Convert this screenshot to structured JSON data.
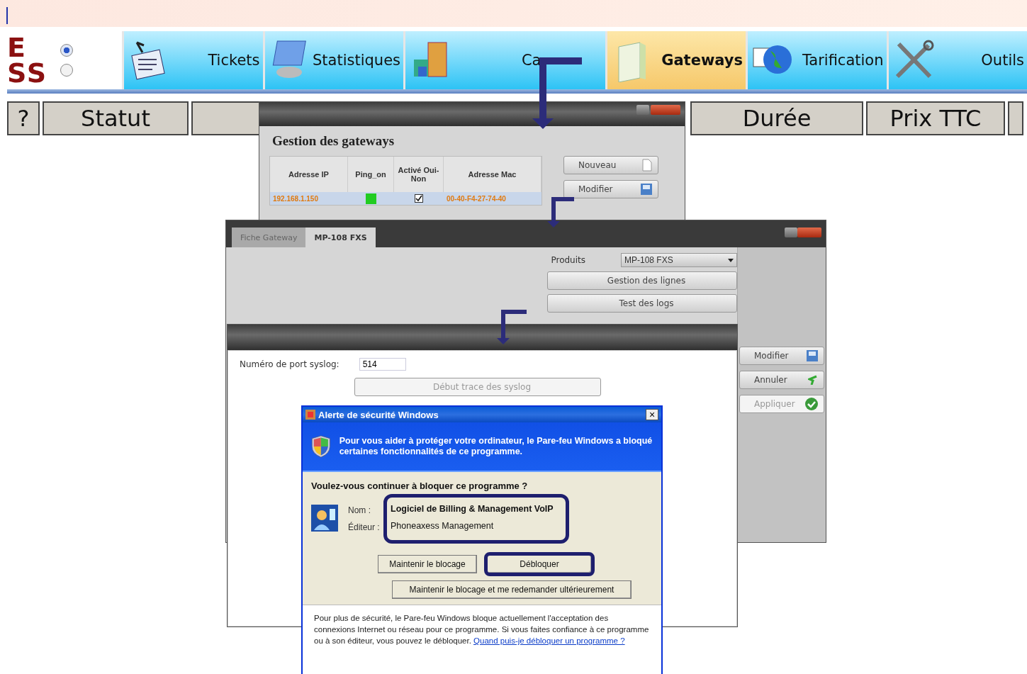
{
  "logo": {
    "lines": [
      "E",
      "SS"
    ]
  },
  "mode_radios": [
    {
      "selected": true
    },
    {
      "selected": false
    }
  ],
  "nav_tabs": [
    {
      "label": "Tickets",
      "selected": false
    },
    {
      "label": "Statistiques",
      "selected": false
    },
    {
      "label": "Ca",
      "selected": false
    },
    {
      "label": "Gateways",
      "selected": true
    },
    {
      "label": "Tarification",
      "selected": false
    },
    {
      "label": "Outils",
      "selected": false
    }
  ],
  "table_header": {
    "left": [
      "?",
      "Statut"
    ],
    "right": [
      "Durée",
      "Prix TTC"
    ]
  },
  "gateways_window": {
    "title": "Gestion des gateways",
    "columns": [
      "Adresse IP",
      "Ping_on",
      "Activé Oui-Non",
      "Adresse Mac"
    ],
    "rows": [
      {
        "ip": "192.168.1.150",
        "ping_on": true,
        "active": true,
        "mac": "00-40-F4-27-74-40",
        "selected": true
      }
    ],
    "buttons": [
      "Nouveau",
      "Modifier"
    ]
  },
  "gateway_window": {
    "tabs": [
      {
        "label": "Fiche Gateway",
        "selected": false
      },
      {
        "label": "MP-108 FXS",
        "selected": true
      }
    ],
    "product_label": "Produits",
    "product_value": "MP-108 FXS",
    "buttons": [
      "Gestion des lignes",
      "Test des logs"
    ],
    "side_buttons": [
      {
        "label": "Modifier",
        "disabled": false
      },
      {
        "label": "Annuler",
        "disabled": false
      },
      {
        "label": "Appliquer",
        "disabled": true
      }
    ]
  },
  "syslog_window": {
    "port_label": "Numéro de port syslog:",
    "port_value": "514",
    "trace_button": {
      "label": "Début trace des syslog",
      "disabled": true
    }
  },
  "security_alert": {
    "title": "Alerte de sécurité Windows",
    "close": "×",
    "banner": "Pour vous aider à protéger votre ordinateur, le Pare-feu Windows a bloqué certaines fonctionnalités de ce programme.",
    "question": "Voulez-vous continuer à bloquer ce programme ?",
    "fields": [
      {
        "label": "Nom :",
        "value": "Logiciel de Billing & Management VoIP",
        "bold": true
      },
      {
        "label": "Éditeur :",
        "value": "Phoneaxess Management",
        "bold": false
      }
    ],
    "buttons": [
      {
        "label": "Maintenir le blocage",
        "highlighted": false
      },
      {
        "label": "Débloquer",
        "highlighted": true
      }
    ],
    "wide_button": "Maintenir le blocage et me redemander ultérieurement",
    "footer": "Pour plus de sécurité, le Pare-feu Windows bloque actuellement l'acceptation des connexions Internet ou réseau pour ce programme. Si vous faites confiance à ce programme ou à son éditeur, vous pouvez le débloquer.",
    "footer_link": "Quand puis-je débloquer un programme ?"
  }
}
